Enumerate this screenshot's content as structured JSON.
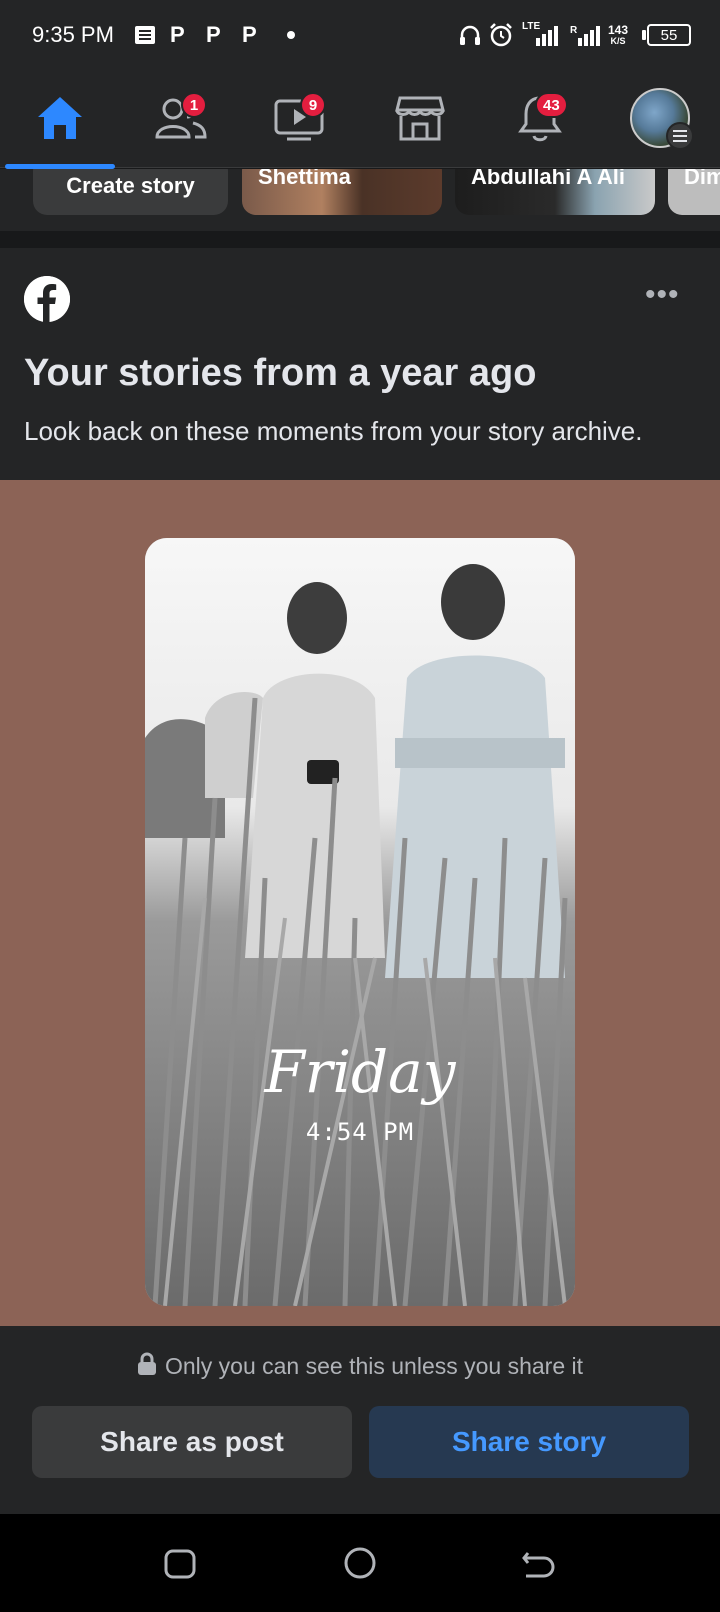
{
  "status_bar": {
    "time": "9:35 PM",
    "notification_icons": [
      "message-icon",
      "p-icon",
      "p-icon",
      "p-icon",
      "dot-icon"
    ],
    "net_type": "LTE",
    "speed_value": "143",
    "speed_unit": "K/S",
    "battery": "55"
  },
  "nav": {
    "tabs": [
      {
        "name": "home",
        "icon": "home-icon",
        "active": true
      },
      {
        "name": "friends",
        "icon": "friends-icon",
        "badge": "1"
      },
      {
        "name": "watch",
        "icon": "video-icon",
        "badge": "9"
      },
      {
        "name": "marketplace",
        "icon": "marketplace-icon"
      },
      {
        "name": "notifications",
        "icon": "bell-icon",
        "badge": "43"
      },
      {
        "name": "menu",
        "icon": "profile-avatar"
      }
    ]
  },
  "stories": {
    "create_label": "Create story",
    "items": [
      "Shettima",
      "Abdullahi A Ali",
      "Dim"
    ]
  },
  "memory_card": {
    "title": "Your stories from a year ago",
    "subtitle": "Look back on these moments from your story archive.",
    "story_overlay": {
      "day": "Friday",
      "time": "4:54 PM"
    },
    "privacy_note": "Only you can see this unless you share it",
    "share_post_label": "Share as post",
    "share_story_label": "Share story"
  },
  "colors": {
    "accent": "#2d88ff",
    "badge": "#e41e3f",
    "media_bg": "#8c6356",
    "share_story_text": "#4599ff"
  }
}
